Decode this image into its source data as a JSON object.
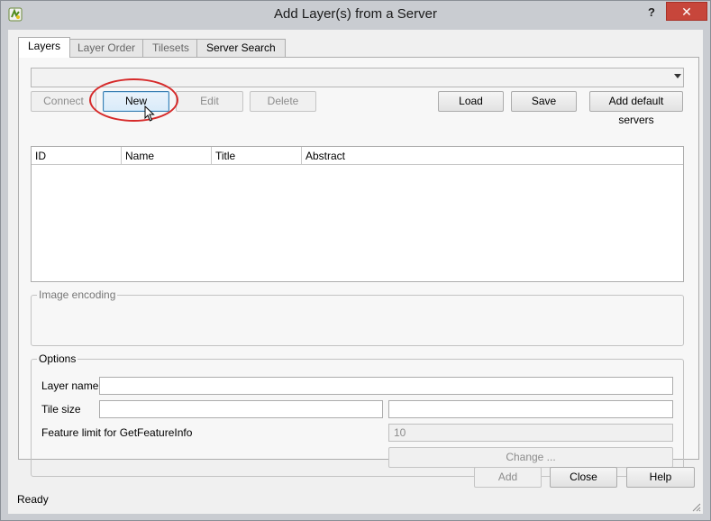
{
  "window": {
    "title": "Add Layer(s) from a Server",
    "help_label": "?",
    "close_label": "✕"
  },
  "tabs": [
    {
      "label": "Layers"
    },
    {
      "label": "Layer Order"
    },
    {
      "label": "Tilesets"
    },
    {
      "label": "Server Search"
    }
  ],
  "server_combo": {
    "value": ""
  },
  "connection_buttons": {
    "connect": "Connect",
    "new": "New",
    "edit": "Edit",
    "delete": "Delete",
    "load": "Load",
    "save": "Save",
    "add_default": "Add default servers"
  },
  "layers_table": {
    "columns": [
      "ID",
      "Name",
      "Title",
      "Abstract"
    ]
  },
  "image_encoding": {
    "title": "Image encoding"
  },
  "options": {
    "title": "Options",
    "layer_name_label": "Layer name",
    "layer_name_value": "",
    "tile_size_label": "Tile size",
    "tile_width_value": "",
    "tile_height_value": "",
    "feature_limit_label": "Feature limit for GetFeatureInfo",
    "feature_limit_value": "10",
    "change_label": "Change ..."
  },
  "dialog_buttons": {
    "add": "Add",
    "close": "Close",
    "help": "Help"
  },
  "status": {
    "text": "Ready"
  },
  "colors": {
    "highlight": "#d62a2a",
    "close_button": "#c7463b",
    "focus_button": "#3c7fb1"
  }
}
